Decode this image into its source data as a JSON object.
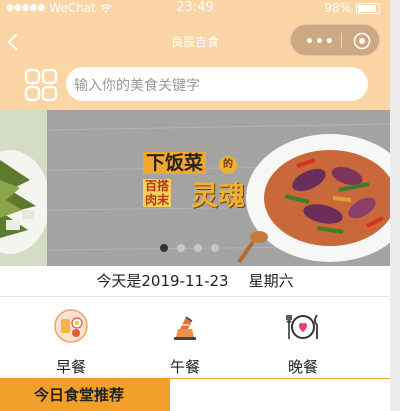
{
  "status_bar": {
    "carrier": "WeChat",
    "time": "23:49",
    "battery": "98%"
  },
  "nav": {
    "title": "良辰吉食"
  },
  "search": {
    "placeholder": "输入你的美食关键字"
  },
  "banner": {
    "headline": "下饭菜",
    "particle": "的",
    "sub_line1": "百搭",
    "sub_line2": "肉末",
    "big_text": "灵魂",
    "indicator_count": 4,
    "active_index": 0
  },
  "date_line": {
    "date_text": "今天是2019-11-23",
    "weekday": "星期六"
  },
  "meals": [
    {
      "label": "早餐",
      "icon": "breakfast-icon"
    },
    {
      "label": "午餐",
      "icon": "lunch-icon"
    },
    {
      "label": "晚餐",
      "icon": "dinner-icon"
    }
  ],
  "section": {
    "title": "今日食堂推荐"
  },
  "colors": {
    "header_bg": "#fbd5a5",
    "accent": "#f3a02b"
  }
}
